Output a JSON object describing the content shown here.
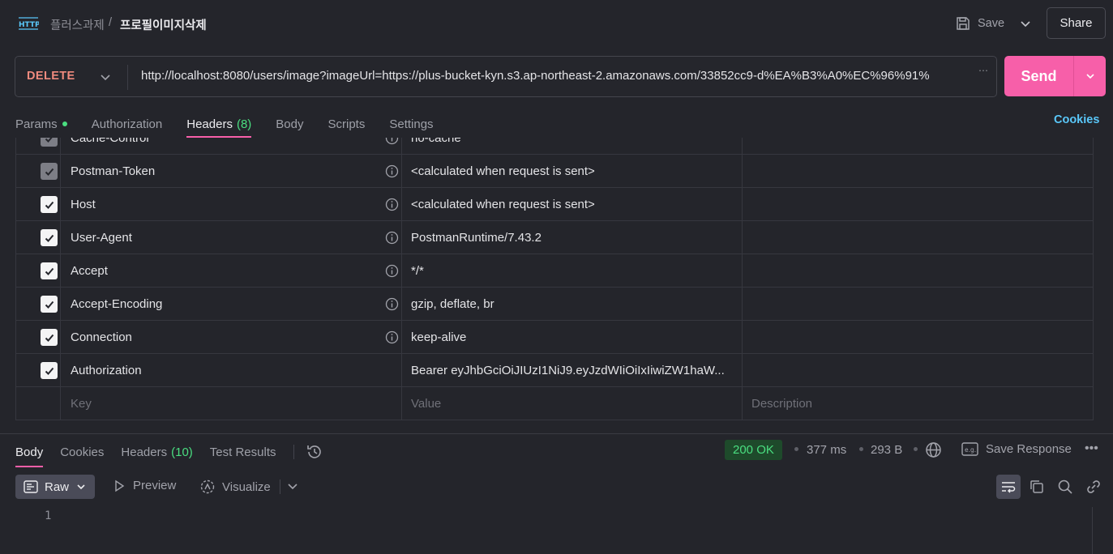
{
  "header": {
    "icon": "http-icon",
    "breadcrumb_parent": "플러스과제",
    "breadcrumb_sep": "/",
    "breadcrumb_current": "프로필이미지삭제",
    "save_label": "Save",
    "share_label": "Share"
  },
  "request": {
    "method": "DELETE",
    "url": "http://localhost:8080/users/image?imageUrl=https://plus-bucket-kyn.s3.ap-northeast-2.amazonaws.com/33852cc9-d%EA%B3%A0%EC%96%91%",
    "send_label": "Send"
  },
  "request_tabs": [
    {
      "label": "Params",
      "count": "",
      "dot": true
    },
    {
      "label": "Authorization",
      "count": ""
    },
    {
      "label": "Headers",
      "count": "(8)",
      "active": true
    },
    {
      "label": "Body",
      "count": ""
    },
    {
      "label": "Scripts",
      "count": ""
    },
    {
      "label": "Settings",
      "count": ""
    }
  ],
  "cookies_label": "Cookies",
  "headers_table": {
    "rows": [
      {
        "key": "Cache-Control",
        "value": "no-cache",
        "checked": true,
        "dim": true,
        "info": true
      },
      {
        "key": "Postman-Token",
        "value": "<calculated when request is sent>",
        "checked": true,
        "dim": true,
        "info": true
      },
      {
        "key": "Host",
        "value": "<calculated when request is sent>",
        "checked": true,
        "dim": false,
        "info": true
      },
      {
        "key": "User-Agent",
        "value": "PostmanRuntime/7.43.2",
        "checked": true,
        "dim": false,
        "info": true
      },
      {
        "key": "Accept",
        "value": "*/*",
        "checked": true,
        "dim": false,
        "info": true
      },
      {
        "key": "Accept-Encoding",
        "value": "gzip, deflate, br",
        "checked": true,
        "dim": false,
        "info": true
      },
      {
        "key": "Connection",
        "value": "keep-alive",
        "checked": true,
        "dim": false,
        "info": true
      },
      {
        "key": "Authorization",
        "value": "Bearer eyJhbGciOiJIUzI1NiJ9.eyJzdWIiOiIxIiwiZW1haW...",
        "checked": true,
        "dim": false,
        "info": false
      }
    ],
    "placeholder_key": "Key",
    "placeholder_value": "Value",
    "placeholder_desc": "Description"
  },
  "response": {
    "tabs": [
      {
        "label": "Body",
        "count": "",
        "active": true
      },
      {
        "label": "Cookies",
        "count": ""
      },
      {
        "label": "Headers",
        "count": "(10)"
      },
      {
        "label": "Test Results",
        "count": ""
      }
    ],
    "status": "200 OK",
    "time": "377 ms",
    "size": "293 B",
    "save_response_label": "Save Response",
    "format_label": "Raw",
    "preview_label": "Preview",
    "visualize_label": "Visualize",
    "line_number": "1"
  },
  "colors": {
    "accent": "#f75fa9",
    "method": "#f08a7e",
    "success": "#4ade80",
    "link": "#5ac8fa"
  }
}
